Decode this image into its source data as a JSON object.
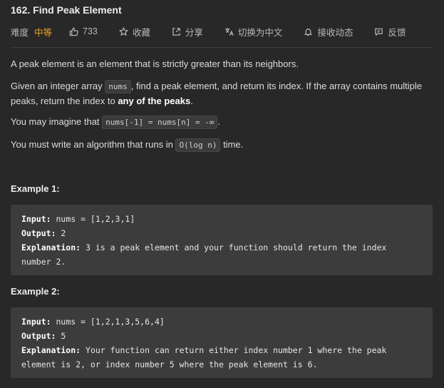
{
  "problem": {
    "title": "162. Find Peak Element"
  },
  "meta": {
    "difficulty_label": "难度",
    "difficulty_value": "中等",
    "likes": "733",
    "favorite": "收藏",
    "share": "分享",
    "switch_lang": "切换为中文",
    "notify": "接收动态",
    "feedback": "反馈",
    "colors": {
      "difficulty": "#f0a020",
      "background": "#282828"
    }
  },
  "description": {
    "p1": "A peak element is an element that is strictly greater than its neighbors.",
    "p2_before": "Given an integer array ",
    "p2_code": "nums",
    "p2_mid": ", find a peak element, and return its index. If the array contains multiple peaks, return the index to ",
    "p2_bold": "any of the peaks",
    "p2_end": ".",
    "p3_before": "You may imagine that ",
    "p3_code": "nums[-1] = nums[n] = -∞",
    "p3_end": ".",
    "p4_before": "You must write an algorithm that runs in ",
    "p4_code": "O(log n)",
    "p4_end": " time."
  },
  "examples": [
    {
      "title": "Example 1:",
      "input_label": "Input:",
      "input_value": " nums = [1,2,3,1]",
      "output_label": "Output:",
      "output_value": " 2",
      "explanation_label": "Explanation:",
      "explanation_line1": " 3 is a peak element and your function should return the index",
      "explanation_line2": "number 2."
    },
    {
      "title": "Example 2:",
      "input_label": "Input:",
      "input_value": " nums = [1,2,1,3,5,6,4]",
      "output_label": "Output:",
      "output_value": " 5",
      "explanation_label": "Explanation:",
      "explanation_line1": " Your function can return either index number 1 where the peak",
      "explanation_line2": "element is 2, or index number 5 where the peak element is 6."
    }
  ]
}
